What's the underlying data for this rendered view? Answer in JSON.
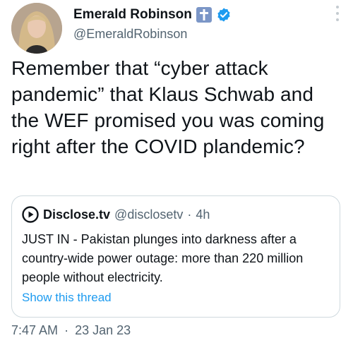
{
  "author": {
    "display_name": "Emerald Robinson",
    "handle": "@EmeraldRobinson",
    "badges": [
      "cross-icon",
      "verified-icon"
    ],
    "avatar": "avatar"
  },
  "tweet": {
    "text": "Remember that “cyber attack pandemic” that Klaus Schwab and the WEF promised you was coming right after the COVID plandemic?"
  },
  "quoted_tweet": {
    "display_name": "Disclose.tv",
    "handle": "@disclosetv",
    "separator": "·",
    "time": "4h",
    "text": "JUST IN - Pakistan plunges into darkness after a country-wide power outage: more than 220 million people without electricity.",
    "show_thread_label": "Show this thread",
    "logo": "play-logo-icon"
  },
  "meta": {
    "time": "7:47 AM",
    "separator": "·",
    "date": "23 Jan 23"
  },
  "colors": {
    "accent": "#1d9bf0",
    "secondary_text": "#536471",
    "border": "#cfd9de",
    "cross_badge": "#7b96c7"
  }
}
